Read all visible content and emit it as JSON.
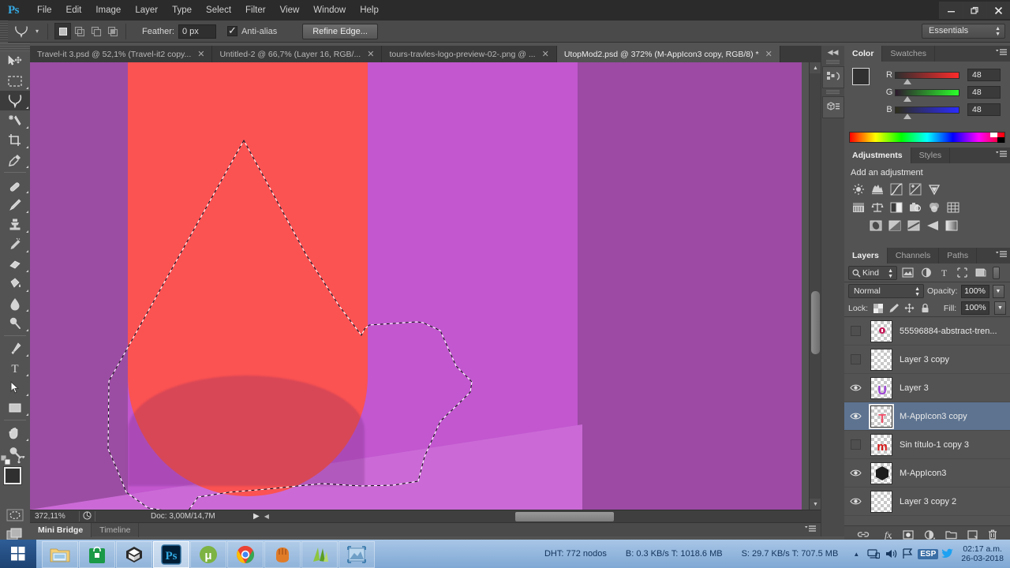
{
  "app": {
    "logo": "Ps",
    "menus": [
      "File",
      "Edit",
      "Image",
      "Layer",
      "Type",
      "Select",
      "Filter",
      "View",
      "Window",
      "Help"
    ],
    "window_buttons": {
      "minimize": "—",
      "restore": "❐",
      "close": "✕"
    }
  },
  "options_bar": {
    "tool_icon": "lasso-tool-icon",
    "preset_caret": "▾",
    "selection_modes": [
      "new-selection",
      "add-to-selection",
      "subtract-from-selection",
      "intersect-selection"
    ],
    "feather_label": "Feather:",
    "feather_value": "0 px",
    "antialias_label": "Anti-alias",
    "antialias_checked": true,
    "refine_edge_label": "Refine Edge...",
    "workspace_label": "Essentials"
  },
  "document_tabs": [
    {
      "label": "Travel-it 3.psd @ 52,1% (Travel-it2 copy...",
      "close": "✕",
      "active": false
    },
    {
      "label": "Untitled-2 @ 66,7% (Layer 16, RGB/...",
      "close": "✕",
      "active": false
    },
    {
      "label": "tours-travles-logo-preview-02-.png @ ...",
      "close": "✕",
      "active": false
    },
    {
      "label": "UtopMod2.psd @ 372% (M-AppIcon3 copy, RGB/8) *",
      "close": "✕",
      "active": true
    }
  ],
  "toolbar": {
    "tools": [
      {
        "name": "move-tool",
        "glyph": "move",
        "has_flyout": false,
        "active": false
      },
      {
        "name": "rectangular-marquee-tool",
        "glyph": "marquee",
        "has_flyout": true,
        "active": false
      },
      {
        "name": "lasso-tool",
        "glyph": "lasso",
        "has_flyout": true,
        "active": true
      },
      {
        "name": "quick-selection-tool",
        "glyph": "magicwand",
        "has_flyout": true,
        "active": false
      },
      {
        "name": "crop-tool",
        "glyph": "crop",
        "has_flyout": true,
        "active": false
      },
      {
        "name": "eyedropper-tool",
        "glyph": "eyedropper",
        "has_flyout": true,
        "active": false
      },
      {
        "name": "spot-healing-brush-tool",
        "glyph": "healing",
        "has_flyout": true,
        "active": false
      },
      {
        "name": "brush-tool",
        "glyph": "brush",
        "has_flyout": true,
        "active": false
      },
      {
        "name": "clone-stamp-tool",
        "glyph": "stamp",
        "has_flyout": true,
        "active": false
      },
      {
        "name": "history-brush-tool",
        "glyph": "historybrush",
        "has_flyout": true,
        "active": false
      },
      {
        "name": "eraser-tool",
        "glyph": "eraser",
        "has_flyout": true,
        "active": false
      },
      {
        "name": "gradient-tool",
        "glyph": "paintbucket",
        "has_flyout": true,
        "active": false
      },
      {
        "name": "blur-tool",
        "glyph": "blur",
        "has_flyout": true,
        "active": false
      },
      {
        "name": "dodge-tool",
        "glyph": "dodge",
        "has_flyout": true,
        "active": false
      },
      {
        "name": "pen-tool",
        "glyph": "pen",
        "has_flyout": true,
        "active": false
      },
      {
        "name": "horizontal-type-tool",
        "glyph": "type",
        "has_flyout": true,
        "active": false
      },
      {
        "name": "path-selection-tool",
        "glyph": "pathselect",
        "has_flyout": true,
        "active": false
      },
      {
        "name": "rectangle-tool",
        "glyph": "rectangle",
        "has_flyout": true,
        "active": false
      },
      {
        "name": "hand-tool",
        "glyph": "hand",
        "has_flyout": true,
        "active": false
      },
      {
        "name": "zoom-tool",
        "glyph": "zoom",
        "has_flyout": false,
        "active": false
      }
    ],
    "foreground_color": "#303030",
    "background_color": "#ffffff",
    "quick_mask_name": "quick-mask-mode",
    "screen_mode_name": "screen-mode"
  },
  "canvas": {
    "background_purple_dark": "#9b4da3",
    "background_purple_light": "#c257cf",
    "floor_purple": "#cb6ad6",
    "red_shape": "#fb5252",
    "selection": "lasso-marching-ants"
  },
  "canvas_status": {
    "zoom": "372,11%",
    "doc_info": "Doc: 3,00M/14,7M"
  },
  "bottom_dock": {
    "tabs": [
      {
        "label": "Mini Bridge",
        "active": true
      },
      {
        "label": "Timeline",
        "active": false
      }
    ]
  },
  "color_panel": {
    "tabs": [
      {
        "label": "Color",
        "active": true
      },
      {
        "label": "Swatches",
        "active": false
      }
    ],
    "channels": [
      {
        "label": "R",
        "value": "48"
      },
      {
        "label": "G",
        "value": "48"
      },
      {
        "label": "B",
        "value": "48"
      }
    ]
  },
  "adjustments_panel": {
    "tabs": [
      {
        "label": "Adjustments",
        "active": true
      },
      {
        "label": "Styles",
        "active": false
      }
    ],
    "title": "Add an adjustment",
    "icons_row1": [
      "brightness-contrast-icon",
      "levels-icon",
      "curves-icon",
      "exposure-icon",
      "vibrance-icon"
    ],
    "icons_row2": [
      "hue-saturation-icon",
      "color-balance-icon",
      "black-white-icon",
      "photo-filter-icon",
      "channel-mixer-icon",
      "color-lookup-icon"
    ],
    "icons_row3": [
      "invert-icon",
      "posterize-icon",
      "threshold-icon",
      "gradient-map-icon",
      "selective-color-icon"
    ]
  },
  "layers_panel": {
    "tabs": [
      {
        "label": "Layers",
        "active": true
      },
      {
        "label": "Channels",
        "active": false
      },
      {
        "label": "Paths",
        "active": false
      }
    ],
    "filter_kind": "Kind",
    "filter_icons": [
      "pixel-layers-filter-icon",
      "adjustment-layers-filter-icon",
      "type-layers-filter-icon",
      "shape-layers-filter-icon",
      "smart-object-filter-icon"
    ],
    "blend_mode": "Normal",
    "opacity_label": "Opacity:",
    "opacity_value": "100%",
    "lock_label": "Lock:",
    "lock_icons": [
      "lock-transparent-pixels-icon",
      "lock-image-pixels-icon",
      "lock-position-icon",
      "lock-all-icon"
    ],
    "fill_label": "Fill:",
    "fill_value": "100%",
    "layers": [
      {
        "name": "55596884-abstract-tren...",
        "visible": false,
        "selected": false,
        "thumb": "pink-dot"
      },
      {
        "name": "Layer 3 copy",
        "visible": false,
        "selected": false,
        "thumb": "empty"
      },
      {
        "name": "Layer 3",
        "visible": true,
        "selected": false,
        "thumb": "purple-u"
      },
      {
        "name": "M-AppIcon3 copy",
        "visible": true,
        "selected": true,
        "thumb": "red-t"
      },
      {
        "name": "Sin título-1 copy 3",
        "visible": false,
        "selected": false,
        "thumb": "red-m"
      },
      {
        "name": "M-AppIcon3",
        "visible": true,
        "selected": false,
        "thumb": "black-hex"
      },
      {
        "name": "Layer 3 copy 2",
        "visible": true,
        "selected": false,
        "thumb": "empty"
      }
    ],
    "footer_icons": [
      "link-layers-icon",
      "layer-styles-fx-icon",
      "add-layer-mask-icon",
      "new-adjustment-layer-icon",
      "new-group-icon",
      "new-layer-icon",
      "delete-layer-icon"
    ]
  },
  "minidock": {
    "collapse": "◀◀",
    "buttons": [
      "history-actions-icon",
      "3d-properties-icon"
    ]
  },
  "taskbar": {
    "start": "windows-start-icon",
    "items": [
      {
        "name": "file-explorer",
        "active": false
      },
      {
        "name": "windows-store",
        "active": false
      },
      {
        "name": "unity",
        "active": false
      },
      {
        "name": "photoshop",
        "active": true
      },
      {
        "name": "utorrent",
        "active": false
      },
      {
        "name": "google-chrome",
        "active": false
      },
      {
        "name": "baseball-glove-app",
        "active": false
      },
      {
        "name": "green-leaf-app",
        "active": false
      },
      {
        "name": "image-viewer-app",
        "active": false
      }
    ],
    "tray": {
      "dht": "DHT: 772 nodos",
      "download": "B: 0.3 KB/s T: 1018.6 MB",
      "upload": "S: 29.7 KB/s T: 707.5 MB",
      "show_hidden": "▲",
      "icons": [
        "network-icon",
        "volume-icon",
        "flag-action-center-icon"
      ],
      "language": "ESP",
      "twitter": "twitter-icon",
      "time": "02:17 a.m.",
      "date": "26-03-2018"
    }
  }
}
